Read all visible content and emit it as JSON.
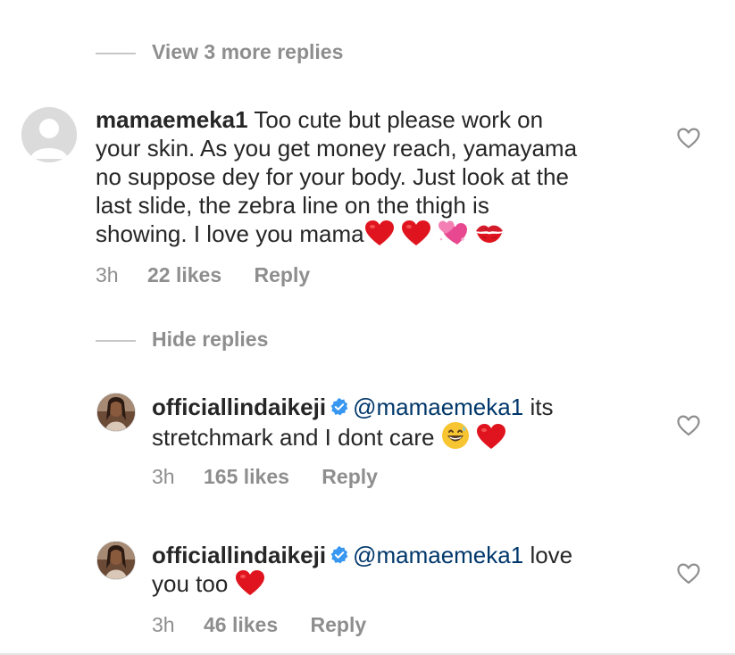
{
  "thread": {
    "view_more_label": "View 3 more replies",
    "hide_replies_label": "Hide replies"
  },
  "comment": {
    "username": "mamaemeka1",
    "text_line1": "Too cute but please work on",
    "text_line2": "your skin. As you get money reach, yamayama",
    "text_line3": "no suppose dey for your body. Just look at the",
    "text_line4": "last slide, the zebra line on the thigh is",
    "text_line5": "showing. I love you mama",
    "emojis": [
      "heart",
      "heart",
      "two-hearts",
      "kiss-mark"
    ],
    "time": "3h",
    "likes": "22 likes",
    "reply_label": "Reply"
  },
  "replies": [
    {
      "username": "officiallindaikeji",
      "verified": true,
      "mention": "@mamaemeka1",
      "text_line1_tail": "its",
      "text_line2": "stretchmark and I dont care",
      "emojis": [
        "grinning-sweat",
        "heart"
      ],
      "time": "3h",
      "likes": "165 likes",
      "reply_label": "Reply"
    },
    {
      "username": "officiallindaikeji",
      "verified": true,
      "mention": "@mamaemeka1",
      "text_line1_tail": "love",
      "text_line2": "you too",
      "emojis": [
        "heart"
      ],
      "time": "3h",
      "likes": "46 likes",
      "reply_label": "Reply"
    }
  ],
  "colors": {
    "text": "#262626",
    "muted": "#8e8e8e",
    "mention": "#00376b",
    "verified_blue": "#3897f0",
    "heart_red": "#e0141e"
  }
}
